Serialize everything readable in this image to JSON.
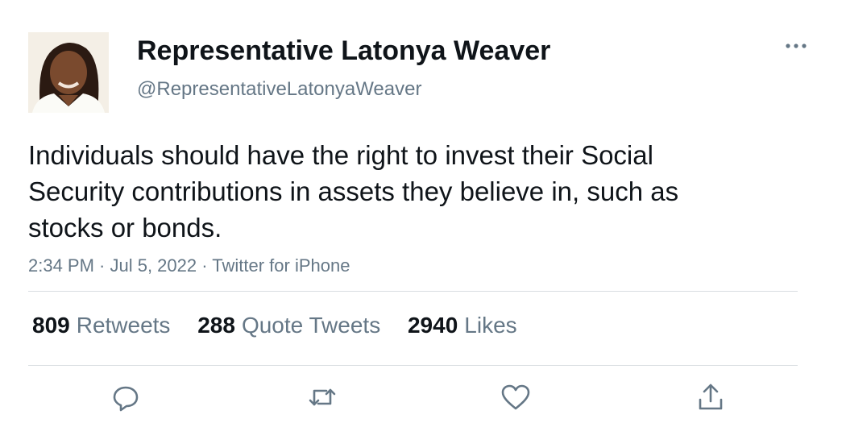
{
  "user": {
    "display_name": "Representative Latonya Weaver",
    "handle": "@RepresentativeLatonyaWeaver"
  },
  "tweet": {
    "text": "Individuals should have the right to invest their Social Security contributions in assets they believe in, such as stocks or bonds.",
    "meta": "2:34 PM · Jul 5, 2022 · Twitter for iPhone"
  },
  "stats": {
    "retweets_count": "809",
    "retweets_label": "Retweets",
    "quotes_count": "288",
    "quotes_label": "Quote Tweets",
    "likes_count": "2940",
    "likes_label": "Likes"
  },
  "actions": [
    "reply-icon",
    "retweet-icon",
    "like-icon",
    "share-icon"
  ],
  "colors": {
    "text": "#0f1419",
    "secondary": "#657786",
    "divider": "#d9dde1"
  }
}
